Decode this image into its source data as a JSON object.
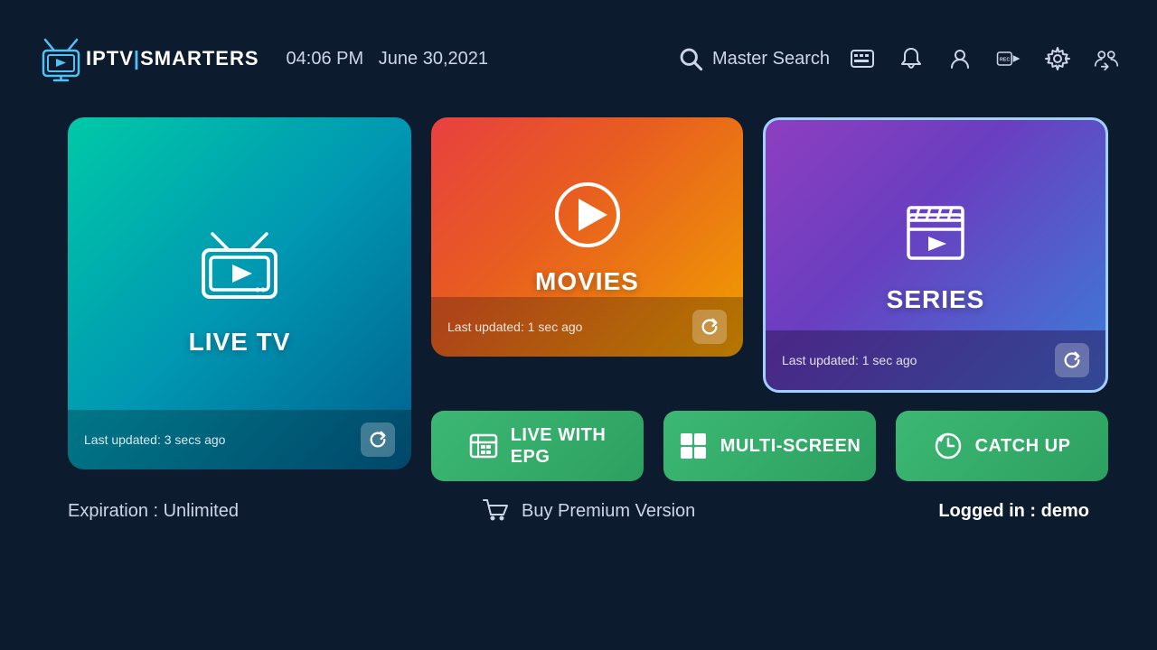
{
  "header": {
    "logo_iptv": "IPTV",
    "logo_smarters": "SMARTERS",
    "time": "04:06 PM",
    "date": "June 30,2021",
    "search_label": "Master Search"
  },
  "icons": {
    "epg": "epg-icon",
    "notification": "bell-icon",
    "profile": "profile-icon",
    "rec": "rec-icon",
    "settings": "settings-icon",
    "switch_user": "switch-user-icon"
  },
  "cards": {
    "live_tv": {
      "title": "LIVE TV",
      "last_updated": "Last updated: 3 secs ago"
    },
    "movies": {
      "title": "MOVIES",
      "last_updated": "Last updated: 1 sec ago"
    },
    "series": {
      "title": "SERIES",
      "last_updated": "Last updated: 1 sec ago"
    }
  },
  "buttons": {
    "live_epg": "LIVE WITH\nEPG",
    "live_epg_line1": "LIVE WITH",
    "live_epg_line2": "EPG",
    "multi_screen": "MULTI-SCREEN",
    "catch_up": "CATCH UP"
  },
  "footer": {
    "expiration": "Expiration : Unlimited",
    "buy_premium": "Buy Premium Version",
    "logged_in_label": "Logged in : ",
    "logged_in_user": "demo"
  }
}
